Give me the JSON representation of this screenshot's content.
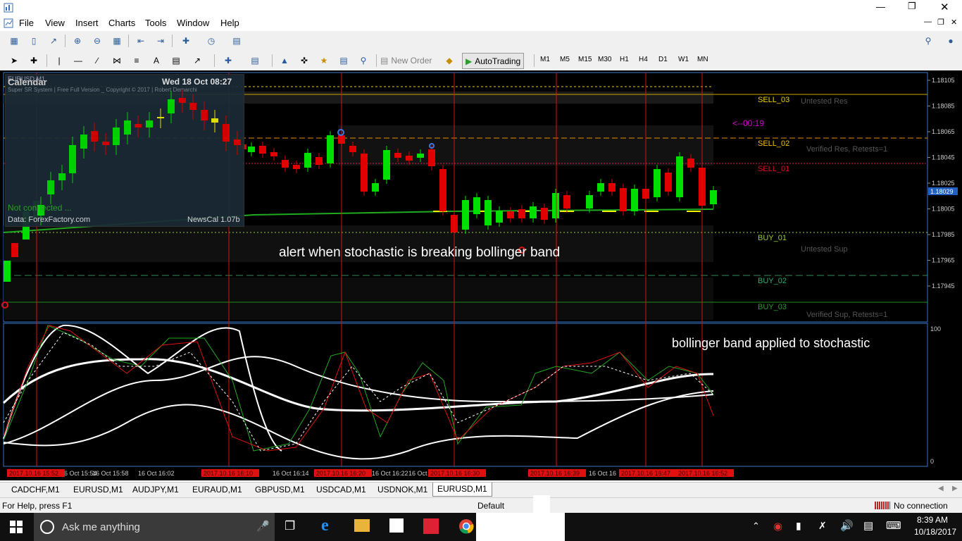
{
  "menu": [
    "File",
    "View",
    "Insert",
    "Charts",
    "Tools",
    "Window",
    "Help"
  ],
  "toolbar": {
    "new_order": "New Order",
    "autotrading": "AutoTrading",
    "timeframes": [
      "M1",
      "M5",
      "M15",
      "M30",
      "H1",
      "H4",
      "D1",
      "W1",
      "MN"
    ]
  },
  "calendar": {
    "title": "Calendar",
    "date": "Wed 18 Oct 08:27",
    "symbol_label": "EURUSD,M1",
    "banner": "Super SR System | Free Full Version _ Copyright © 2017 | Robert Demarchi",
    "status": "Not connected ...",
    "source": "Data: ForexFactory.com",
    "version": "NewsCal 1.07b"
  },
  "chart": {
    "sr_labels": {
      "sell_03": "SELL_03",
      "sell_02": "SELL_02",
      "sell_01": "SELL_01",
      "buy_01": "BUY_01",
      "buy_02": "BUY_02",
      "buy_03": "BUY_03"
    },
    "zone_labels": {
      "untested_res": "Untested Res",
      "verified_res": "Verified Res, Retests=1",
      "untested_sup": "Untested Sup",
      "verified_sup": "Verified Sup, Retests=1"
    },
    "countdown": "<--00:19",
    "annotation_main": "alert when stochastic is breaking bollinger band",
    "annotation_sub": "bollinger band applied to stochastic",
    "price_scale": [
      "1.18105",
      "1.18085",
      "1.18065",
      "1.18045",
      "1.18025",
      "1.18005",
      "1.17985",
      "1.17965",
      "1.17945"
    ],
    "current_price": "1.18029",
    "sub_scale": [
      "100",
      "0"
    ],
    "time_labels": [
      "16 Oct 15:54",
      "16 Oct 15:58",
      "16 Oct 16:02",
      "16 Oct 16:14",
      "16 Oct 16:22",
      "16 Oct 16",
      "16 Oct 16"
    ],
    "time_markers": [
      "2017.10.16 15:52",
      "2017.10.16 16:10",
      "2017.10.16 16:20",
      "2017.10.16 16:30",
      "2017.10.16 16:39",
      "2017.10.16 16:47",
      "2017.10.16 16:52"
    ],
    "colors": {
      "bull": "#00e000",
      "bear": "#e00000",
      "sell": "#f0c000",
      "buy": "#2ca52c",
      "vline": "#e01010"
    }
  },
  "tabs": [
    "CADCHF,M1",
    "EURUSD,M1",
    "AUDJPY,M1",
    "EURAUD,M1",
    "GBPUSD,M1",
    "USDCAD,M1",
    "USDNOK,M1",
    "EURUSD,M1"
  ],
  "active_tab_index": 7,
  "status": {
    "help": "For Help, press F1",
    "profile": "Default",
    "connection": "No connection"
  },
  "taskbar": {
    "search_placeholder": "Ask me anything",
    "time": "8:39 AM",
    "date": "10/18/2017"
  }
}
